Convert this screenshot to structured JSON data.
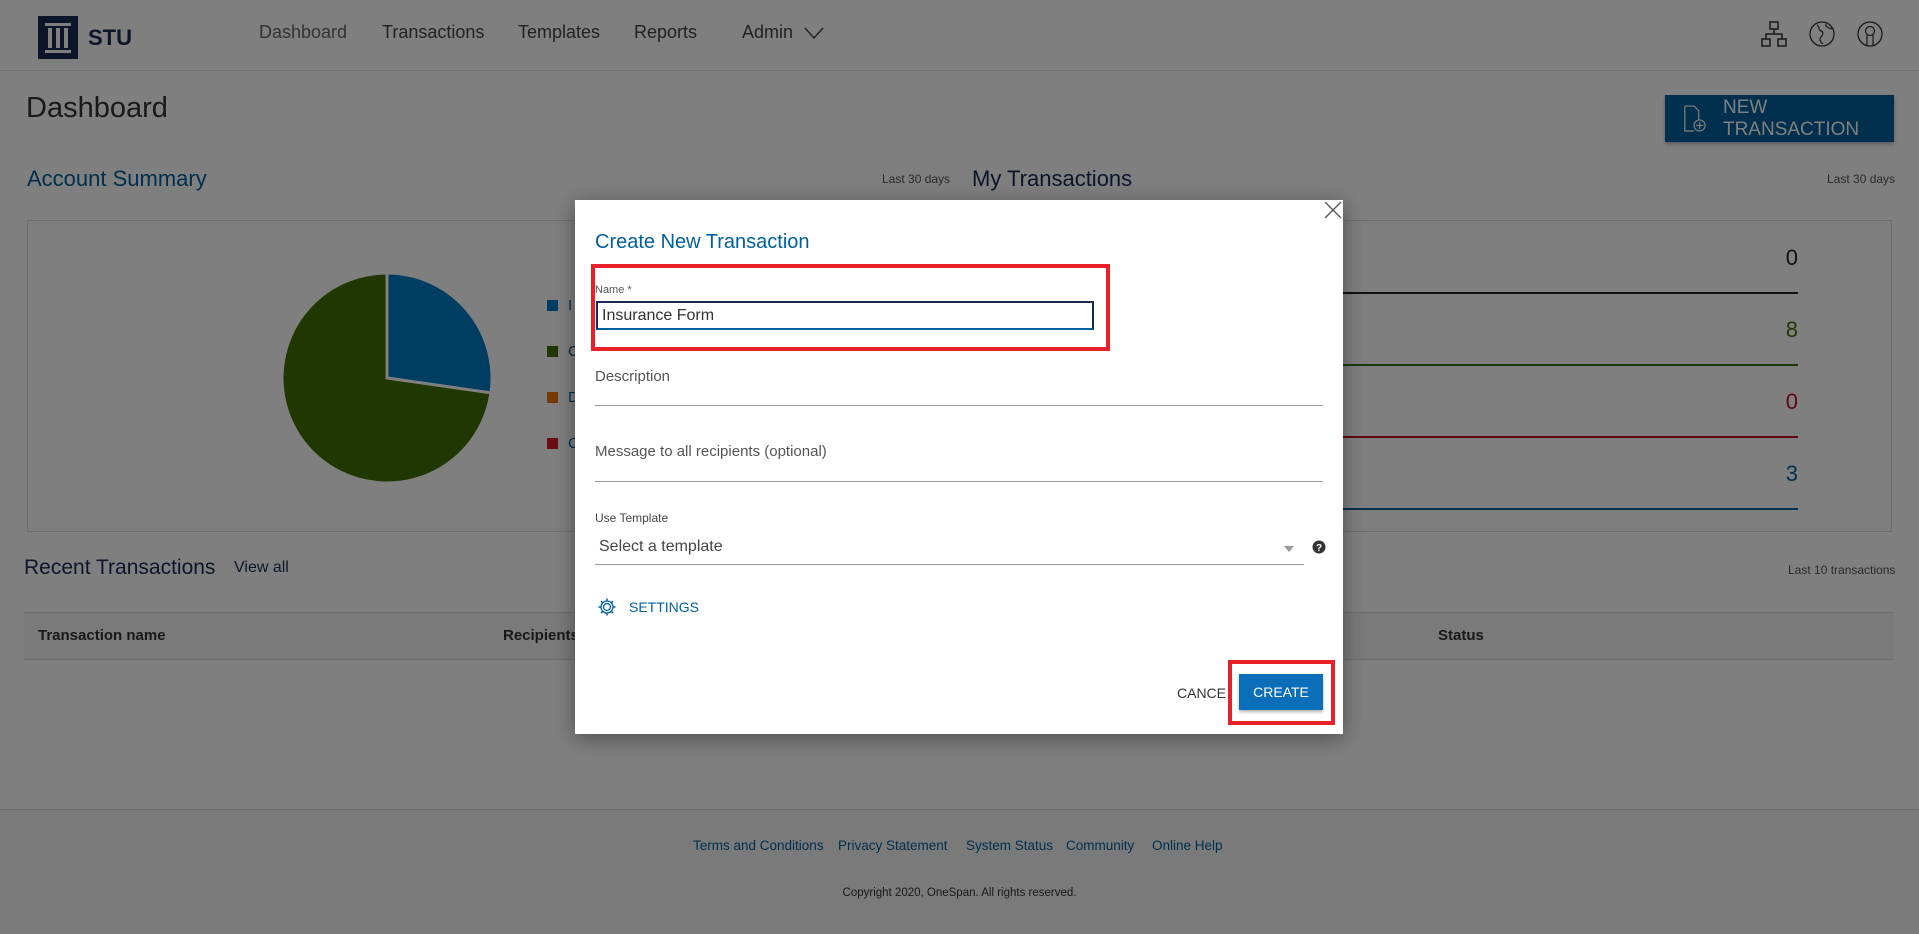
{
  "brand": {
    "name": "STU"
  },
  "nav": {
    "items": [
      "Dashboard",
      "Transactions",
      "Templates",
      "Reports",
      "Admin"
    ]
  },
  "header_icons": [
    "sitemap-icon",
    "globe-icon",
    "user-icon"
  ],
  "page": {
    "title": "Dashboard",
    "new_transaction_label": "NEW TRANSACTION"
  },
  "account_summary": {
    "title": "Account Summary",
    "period": "Last 30 days",
    "legend": [
      {
        "label": "I",
        "color": "#007ac4"
      },
      {
        "label": "C",
        "color": "#407000"
      },
      {
        "label": "D",
        "color": "#f07800"
      },
      {
        "label": "C",
        "color": "#d61c28"
      }
    ]
  },
  "chart_data": {
    "type": "pie",
    "values": [
      3,
      8,
      0,
      0
    ],
    "colors": [
      "#007ac4",
      "#407000",
      "#f07800",
      "#d61c28"
    ],
    "legend": [
      "I",
      "C",
      "D",
      "C"
    ]
  },
  "my_transactions": {
    "title": "My Transactions",
    "period": "Last 30 days",
    "rows": [
      {
        "value": "0",
        "color": "#222222"
      },
      {
        "value": "8",
        "color": "#407000"
      },
      {
        "value": "0",
        "color": "#c0101c"
      },
      {
        "value": "3",
        "color": "#00609c"
      }
    ]
  },
  "recent": {
    "title": "Recent Transactions",
    "view_all": "View all",
    "note": "Last 10 transactions",
    "columns": [
      "Transaction name",
      "Recipients",
      "Status"
    ]
  },
  "footer": {
    "links": [
      "Terms and Conditions",
      "Privacy Statement",
      "System Status",
      "Community",
      "Online Help"
    ],
    "copyright": "Copyright 2020, OneSpan. All rights reserved."
  },
  "modal": {
    "title": "Create New Transaction",
    "name_label": "Name *",
    "name_value": "Insurance Form",
    "description_label": "Description",
    "message_label": "Message to all recipients (optional)",
    "template_label": "Use Template",
    "template_placeholder": "Select a template",
    "settings_label": "SETTINGS",
    "cancel_label": "CANCEL",
    "create_label": "CREATE"
  }
}
